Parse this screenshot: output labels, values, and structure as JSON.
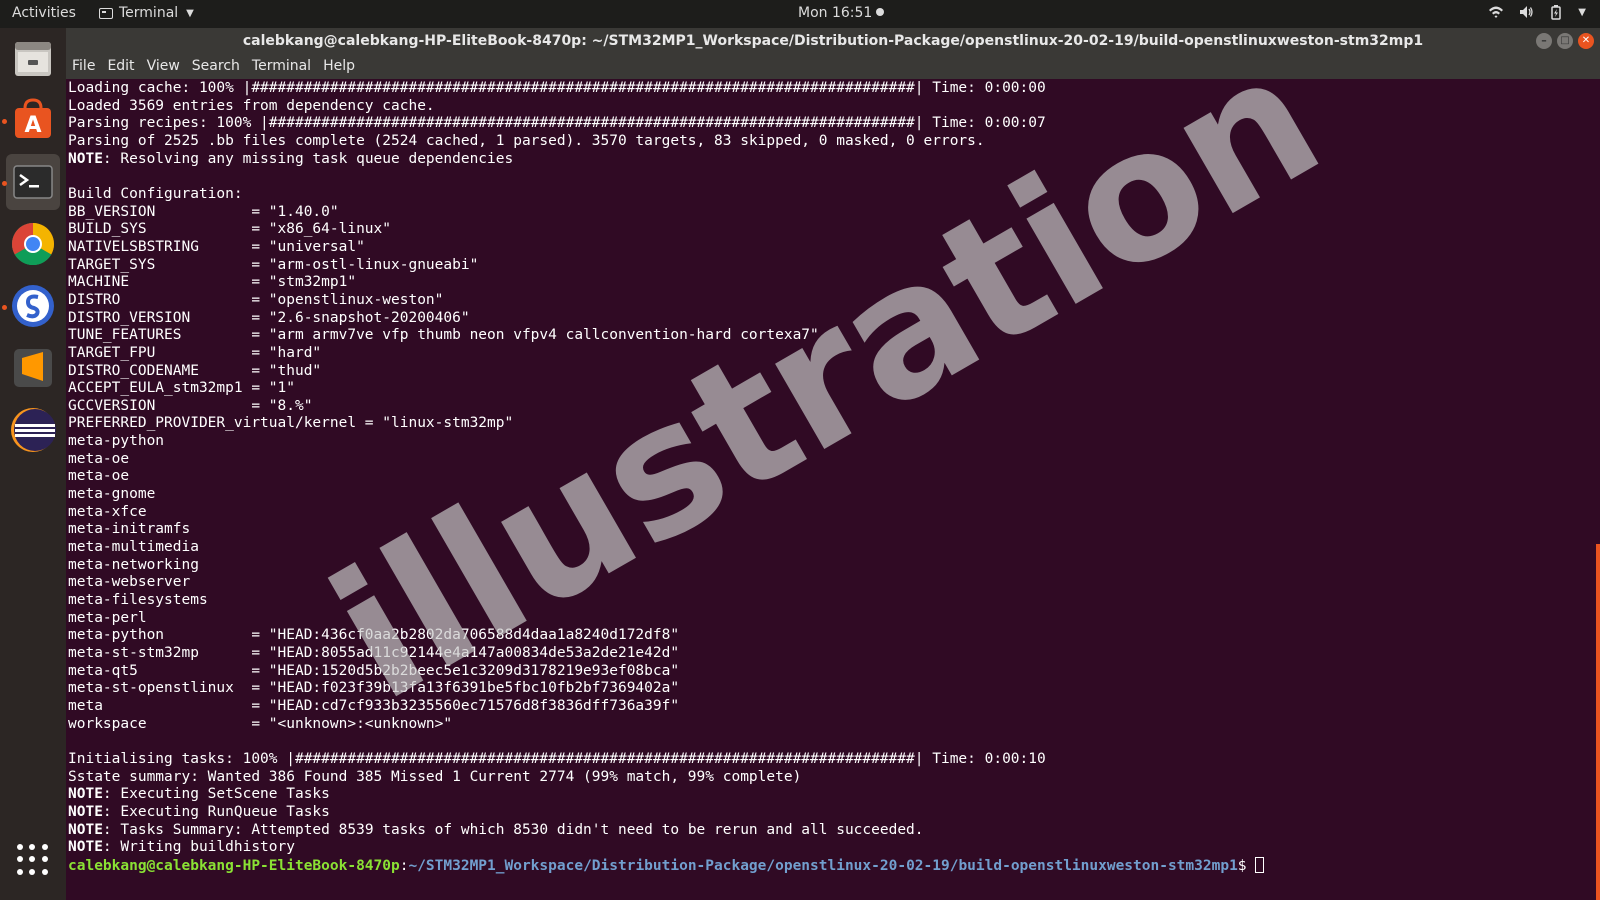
{
  "topbar": {
    "activities": "Activities",
    "app_name": "Terminal",
    "clock": "Mon 16:51"
  },
  "dock": {
    "items": [
      {
        "name": "files-icon"
      },
      {
        "name": "ubuntu-software-icon"
      },
      {
        "name": "terminal-icon"
      },
      {
        "name": "chrome-icon"
      },
      {
        "name": "simplenote-icon"
      },
      {
        "name": "sublime-text-icon"
      },
      {
        "name": "eclipse-icon"
      }
    ]
  },
  "window": {
    "title": "calebkang@calebkang-HP-EliteBook-8470p: ~/STM32MP1_Workspace/Distribution-Package/openstlinux-20-02-19/build-openstlinuxweston-stm32mp1"
  },
  "menu": [
    "File",
    "Edit",
    "View",
    "Search",
    "Terminal",
    "Help"
  ],
  "terminal": {
    "lines": [
      {
        "text": "Loading cache: 100% |############################################################################| Time: 0:00:00"
      },
      {
        "text": "Loaded 3569 entries from dependency cache."
      },
      {
        "text": "Parsing recipes: 100% |##########################################################################| Time: 0:00:07"
      },
      {
        "text": "Parsing of 2525 .bb files complete (2524 cached, 1 parsed). 3570 targets, 83 skipped, 0 masked, 0 errors."
      },
      {
        "note": "NOTE",
        "text": ": Resolving any missing task queue dependencies"
      },
      {
        "text": ""
      },
      {
        "text": "Build Configuration:"
      },
      {
        "text": "BB_VERSION           = \"1.40.0\""
      },
      {
        "text": "BUILD_SYS            = \"x86_64-linux\""
      },
      {
        "text": "NATIVELSBSTRING      = \"universal\""
      },
      {
        "text": "TARGET_SYS           = \"arm-ostl-linux-gnueabi\""
      },
      {
        "text": "MACHINE              = \"stm32mp1\""
      },
      {
        "text": "DISTRO               = \"openstlinux-weston\""
      },
      {
        "text": "DISTRO_VERSION       = \"2.6-snapshot-20200406\""
      },
      {
        "text": "TUNE_FEATURES        = \"arm armv7ve vfp thumb neon vfpv4 callconvention-hard cortexa7\""
      },
      {
        "text": "TARGET_FPU           = \"hard\""
      },
      {
        "text": "DISTRO_CODENAME      = \"thud\""
      },
      {
        "text": "ACCEPT_EULA_stm32mp1 = \"1\""
      },
      {
        "text": "GCCVERSION           = \"8.%\""
      },
      {
        "text": "PREFERRED_PROVIDER_virtual/kernel = \"linux-stm32mp\""
      },
      {
        "text": "meta-python"
      },
      {
        "text": "meta-oe"
      },
      {
        "text": "meta-oe"
      },
      {
        "text": "meta-gnome"
      },
      {
        "text": "meta-xfce"
      },
      {
        "text": "meta-initramfs"
      },
      {
        "text": "meta-multimedia"
      },
      {
        "text": "meta-networking"
      },
      {
        "text": "meta-webserver"
      },
      {
        "text": "meta-filesystems"
      },
      {
        "text": "meta-perl"
      },
      {
        "text": "meta-python          = \"HEAD:436cf0aa2b2802da706588d4daa1a8240d172df8\""
      },
      {
        "text": "meta-st-stm32mp      = \"HEAD:8055ad11c92144e4a147a00834de53a2de21e42d\""
      },
      {
        "text": "meta-qt5             = \"HEAD:1520d5b2b2beec5e1c3209d3178219e93ef08bca\""
      },
      {
        "text": "meta-st-openstlinux  = \"HEAD:f023f39b13fa13f6391be5fbc10fb2bf7369402a\""
      },
      {
        "text": "meta                 = \"HEAD:cd7cf933b3235560ec71576d8f3836dff736a39f\""
      },
      {
        "text": "workspace            = \"<unknown>:<unknown>\""
      },
      {
        "text": ""
      },
      {
        "text": "Initialising tasks: 100% |#######################################################################| Time: 0:00:10"
      },
      {
        "text": "Sstate summary: Wanted 386 Found 385 Missed 1 Current 2774 (99% match, 99% complete)"
      },
      {
        "note": "NOTE",
        "text": ": Executing SetScene Tasks"
      },
      {
        "note": "NOTE",
        "text": ": Executing RunQueue Tasks"
      },
      {
        "note": "NOTE",
        "text": ": Tasks Summary: Attempted 8539 tasks of which 8530 didn't need to be rerun and all succeeded."
      },
      {
        "note": "NOTE",
        "text": ": Writing buildhistory"
      }
    ],
    "prompt_user": "calebkang@calebkang-HP-EliteBook-8470p",
    "prompt_sep": ":",
    "prompt_path": "~/STM32MP1_Workspace/Distribution-Package/openstlinux-20-02-19/build-openstlinuxweston-stm32mp1",
    "prompt_symbol": "$ "
  },
  "watermark": "illustration",
  "colors": {
    "terminal_bg": "#300a24",
    "prompt_user": "#8ae234",
    "prompt_path": "#729fcf",
    "accent": "#e95420"
  }
}
